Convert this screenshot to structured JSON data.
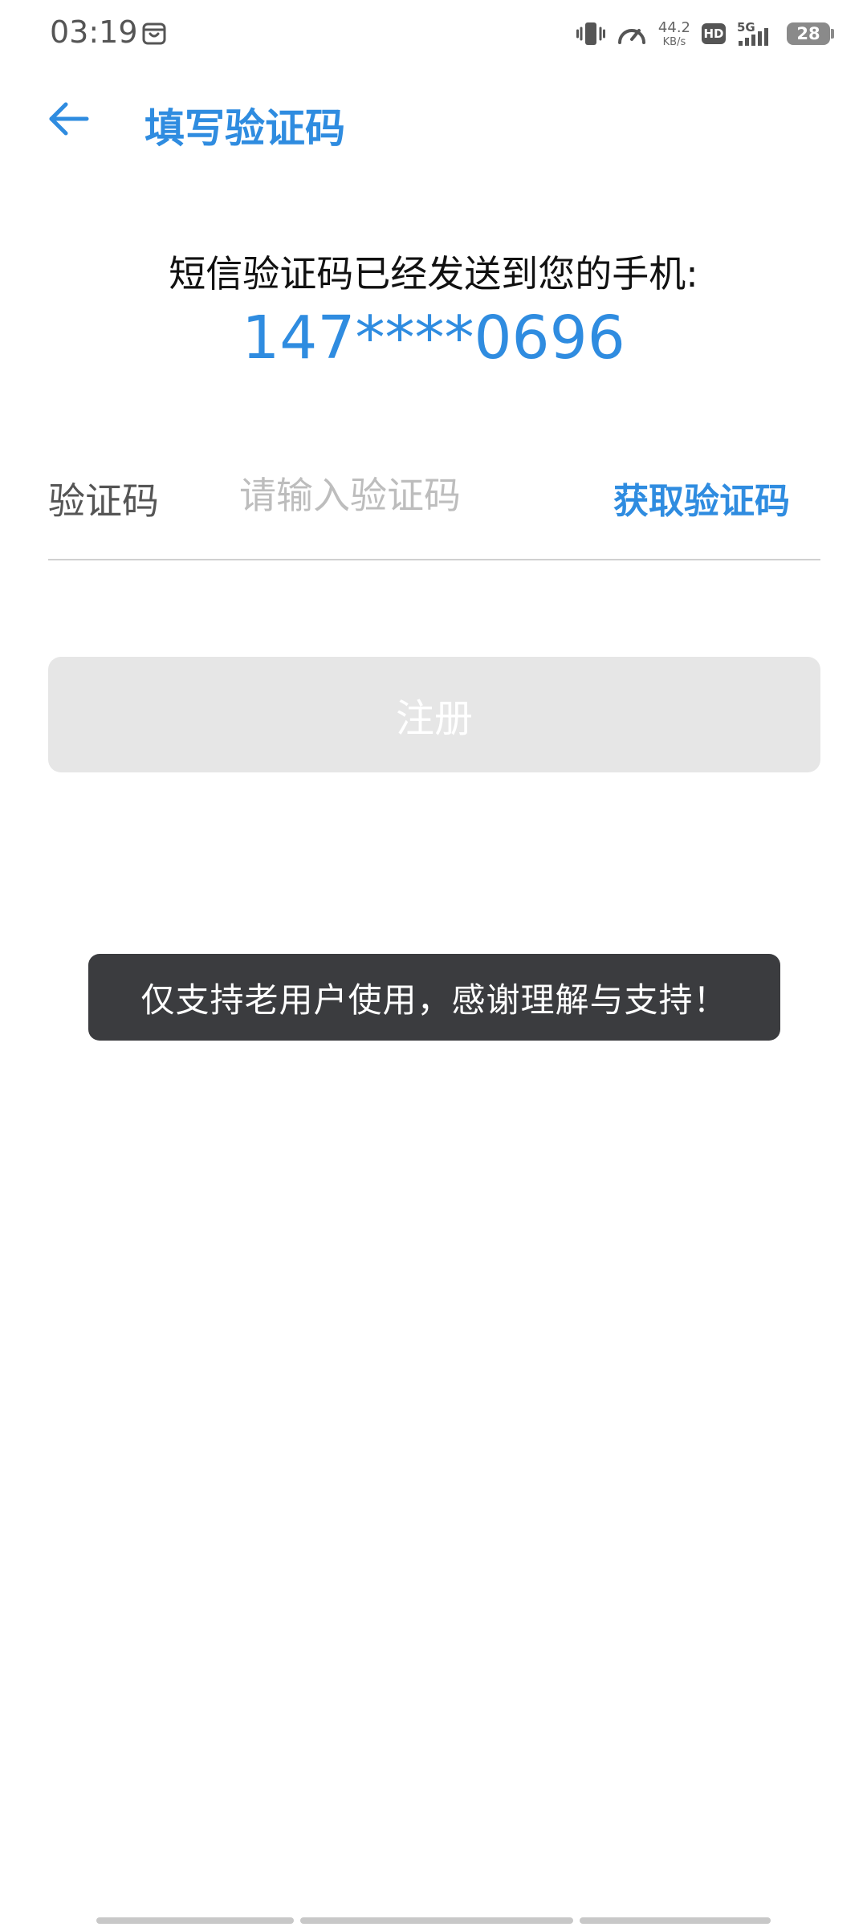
{
  "status_bar": {
    "time": "03:19",
    "speed_value": "44.2",
    "speed_unit": "KB/s",
    "hd_label": "HD",
    "network_label": "5G",
    "battery_level": "28"
  },
  "header": {
    "title": "填写验证码"
  },
  "main": {
    "sms_notice": "短信验证码已经发送到您的手机:",
    "phone_number": "147****0696",
    "code_label": "验证码",
    "code_placeholder": "请输入验证码",
    "code_value": "",
    "get_code_label": "获取验证码",
    "register_label": "注册"
  },
  "toast": {
    "message": "仅支持老用户使用，感谢理解与支持！"
  },
  "colors": {
    "accent": "#2f8ce0",
    "button_disabled": "#e6e6e6",
    "toast_bg": "#3b3c3f"
  }
}
